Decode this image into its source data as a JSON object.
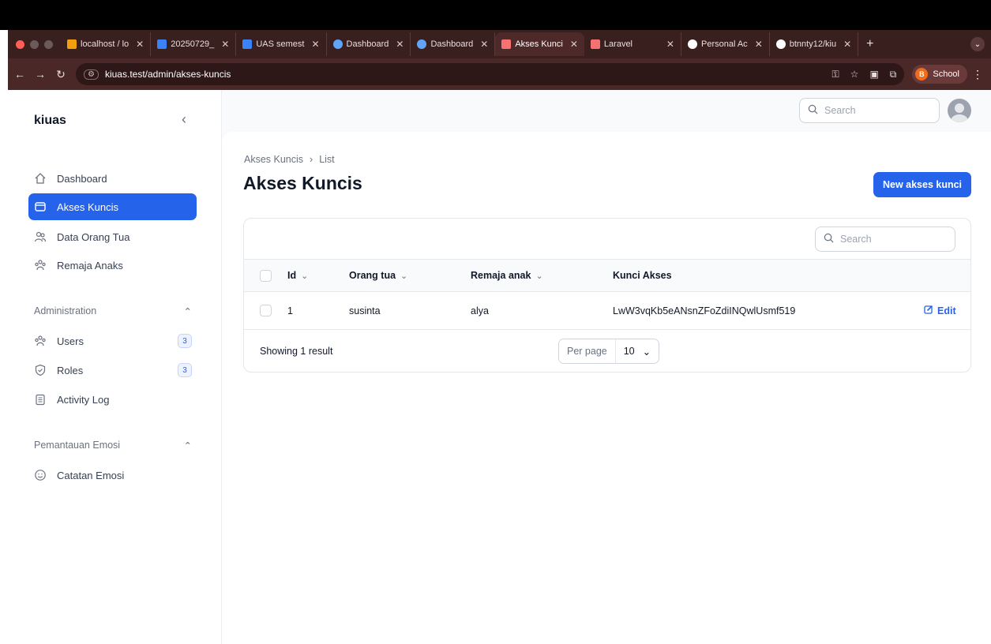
{
  "browser": {
    "tabs": [
      {
        "label": "localhost / lo",
        "icon": "phpmyadmin-icon",
        "color": "#f59e0b"
      },
      {
        "label": "20250729_",
        "icon": "docs-icon",
        "color": "#3b82f6"
      },
      {
        "label": "UAS semest",
        "icon": "docs-icon",
        "color": "#3b82f6"
      },
      {
        "label": "Dashboard",
        "icon": "app-icon",
        "color": "#60a5fa"
      },
      {
        "label": "Dashboard",
        "icon": "app-icon",
        "color": "#60a5fa"
      },
      {
        "label": "Akses Kunci",
        "icon": "laravel-icon",
        "color": "#f87171",
        "active": true
      },
      {
        "label": "Laravel",
        "icon": "laravel-icon",
        "color": "#f87171"
      },
      {
        "label": "Personal Ac",
        "icon": "github-icon",
        "color": "#ffffff"
      },
      {
        "label": "btnnty12/kiu",
        "icon": "github-icon",
        "color": "#ffffff"
      }
    ],
    "url": "kiuas.test/admin/akses-kuncis",
    "profile_initial": "B",
    "profile_label": "School"
  },
  "sidebar": {
    "brand": "kiuas",
    "items": [
      {
        "label": "Dashboard",
        "icon": "home-icon",
        "active": false
      },
      {
        "label": "Akses Kuncis",
        "icon": "folder-icon",
        "active": true
      },
      {
        "label": "Data Orang Tua",
        "icon": "users-icon",
        "active": false
      },
      {
        "label": "Remaja Anaks",
        "icon": "user-group-icon",
        "active": false
      }
    ],
    "admin_group": "Administration",
    "admin_items": [
      {
        "label": "Users",
        "icon": "user-group-icon",
        "badge": "3"
      },
      {
        "label": "Roles",
        "icon": "shield-icon",
        "badge": "3"
      },
      {
        "label": "Activity Log",
        "icon": "clipboard-icon",
        "badge": ""
      }
    ],
    "emotion_group": "Pemantauan Emosi",
    "emotion_items": [
      {
        "label": "Catatan Emosi",
        "icon": "smile-icon"
      }
    ]
  },
  "topbar": {
    "search_placeholder": "Search"
  },
  "page": {
    "breadcrumb": [
      "Akses Kuncis",
      "List"
    ],
    "title": "Akses Kuncis",
    "new_button": "New akses kunci"
  },
  "table": {
    "search_placeholder": "Search",
    "columns": [
      "Id",
      "Orang tua",
      "Remaja anak",
      "Kunci Akses"
    ],
    "rows": [
      {
        "id": "1",
        "orang_tua": "susinta",
        "remaja_anak": "alya",
        "kunci_akses": "LwW3vqKb5eANsnZFoZdiINQwlUsmf519",
        "action": "Edit"
      }
    ],
    "footer_text": "Showing 1 result",
    "per_page_label": "Per page",
    "per_page_value": "10"
  },
  "colors": {
    "accent": "#2563eb",
    "browser_bg": "#3a1f1f"
  }
}
